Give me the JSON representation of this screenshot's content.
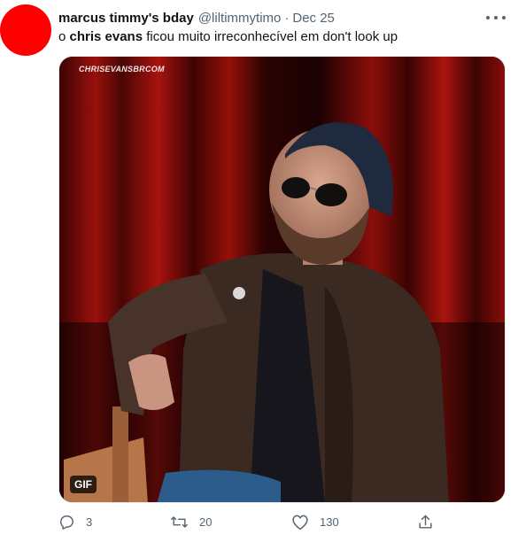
{
  "tweet": {
    "avatar_color": "#ff0000",
    "display_name": "marcus timmy's bday",
    "handle": "@liltimmytimo",
    "separator": "·",
    "date": "Dec 25",
    "more_icon": "more-horizontal-icon",
    "text_prefix": "o ",
    "text_bold": "chris evans",
    "text_suffix": " ficou muito irreconhecível em don't look up"
  },
  "media": {
    "watermark": "CHRISEVANSBRCOM",
    "badge": "GIF",
    "description_colors": {
      "curtain": "#8a0d0a",
      "jacket": "#3b2a22"
    }
  },
  "actions": {
    "reply": {
      "icon": "reply-icon",
      "count": "3"
    },
    "retweet": {
      "icon": "retweet-icon",
      "count": "20"
    },
    "like": {
      "icon": "heart-icon",
      "count": "130"
    },
    "share": {
      "icon": "share-icon"
    }
  },
  "colors": {
    "text": "#0f1419",
    "secondary": "#536471"
  }
}
